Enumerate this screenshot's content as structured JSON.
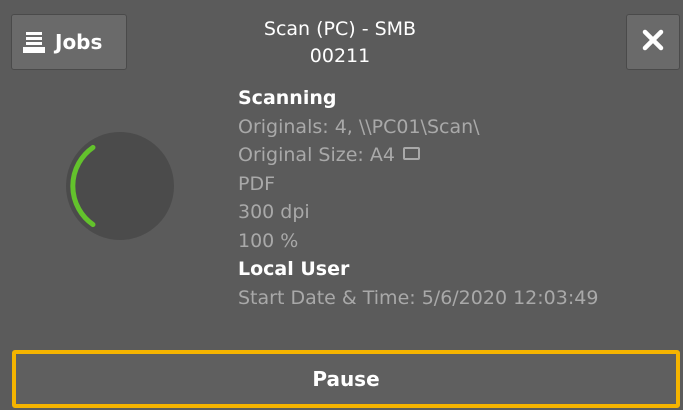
{
  "header": {
    "jobs_label": "Jobs",
    "jobs_icon": "job-list-icon",
    "title": "Scan (PC) - SMB",
    "job_number": "00211",
    "close_icon": "close-icon"
  },
  "status": {
    "spinner_icon": "progress-spinner-icon",
    "progress_color": "#63c22c"
  },
  "details": {
    "state": "Scanning",
    "originals": "Originals: 4, \\\\PC01\\Scan\\",
    "original_size": "Original Size: A4",
    "original_size_icon": "landscape-page-icon",
    "format": "PDF",
    "resolution": "300 dpi",
    "scale": "100 %",
    "user": "Local User",
    "start_time": "Start Date & Time: 5/6/2020 12:03:49"
  },
  "footer": {
    "pause_label": "Pause",
    "highlight_color": "#f5b400"
  }
}
